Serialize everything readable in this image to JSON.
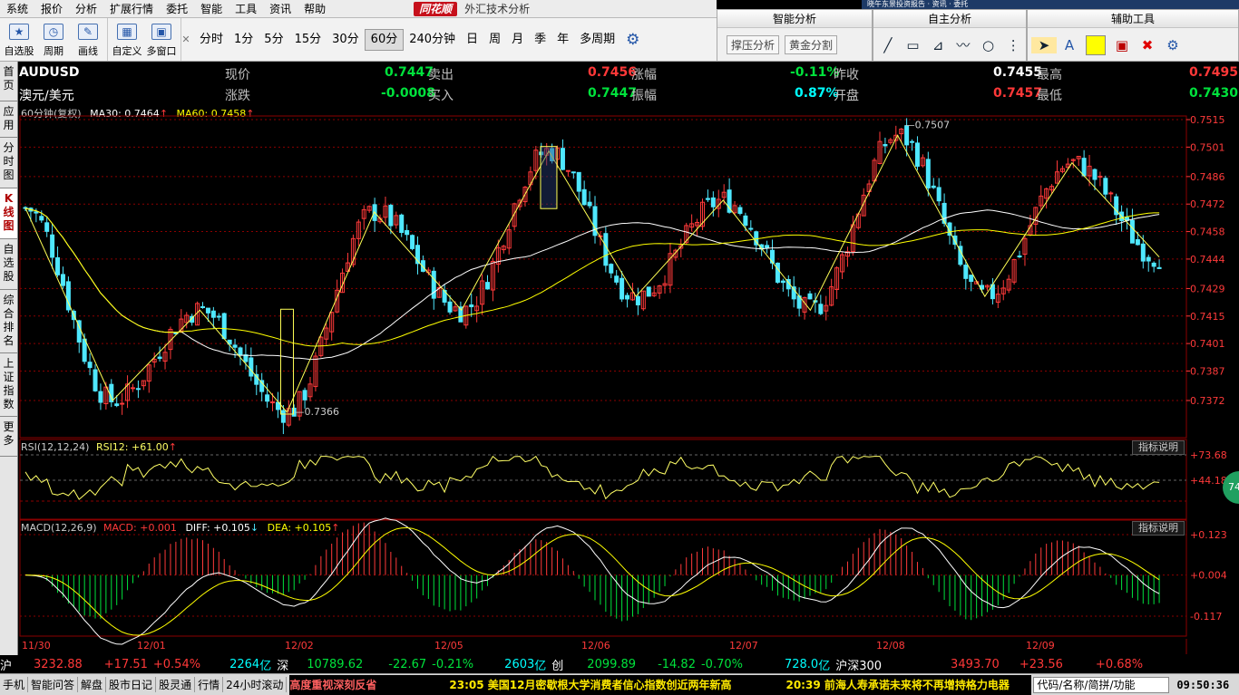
{
  "menu": {
    "items": [
      "系统",
      "报价",
      "分析",
      "扩展行情",
      "委托",
      "智能",
      "工具",
      "资讯",
      "帮助"
    ],
    "brand": "同花顺",
    "window_title": "外汇技术分析"
  },
  "toolbar": {
    "buttons": [
      {
        "label": "自选股",
        "icon": "star-icon"
      },
      {
        "label": "周期",
        "icon": "clock-icon"
      },
      {
        "label": "画线",
        "icon": "pen-icon"
      },
      {
        "label": "自定义",
        "icon": "custom-icon"
      },
      {
        "label": "多窗口",
        "icon": "window-icon"
      }
    ],
    "periods": [
      "分时",
      "1分",
      "5分",
      "15分",
      "30分",
      "60分",
      "240分钟",
      "日",
      "周",
      "月",
      "季",
      "年",
      "多周期"
    ],
    "active_period": "60分"
  },
  "panels": {
    "smart": {
      "title": "智能分析",
      "b1": "撑压分析",
      "b2": "黄金分割"
    },
    "self": {
      "title": "自主分析"
    },
    "aux": {
      "title": "辅助工具",
      "icon_a": "A"
    }
  },
  "topstrip": {
    "text": "晓午东景投资报告 · 资讯 · 委托"
  },
  "sidebar": {
    "tabs": [
      "首页",
      "应用",
      "分时图",
      "K线图",
      "自选股",
      "综合排名",
      "上证指数",
      "更多"
    ],
    "active": "K线图"
  },
  "quote": {
    "symbol": "AUDUSD",
    "name": "澳元/美元",
    "now_label": "现价",
    "now": "0.7447",
    "sell_label": "卖出",
    "sell": "0.7456",
    "rise_pct_label": "涨幅",
    "rise_pct": "-0.11%",
    "prev_close_label": "昨收",
    "prev_close": "0.7455",
    "high_label": "最高",
    "high": "0.7495",
    "change_label": "涨跌",
    "change": "-0.0008",
    "buy_label": "买入",
    "buy": "0.7447",
    "amp_label": "振幅",
    "amp": "0.87%",
    "open_label": "开盘",
    "open": "0.7457",
    "low_label": "最低",
    "low": "0.7430"
  },
  "main_chart": {
    "info": "60分钟(复权)",
    "ma30": "MA30: 0.7464",
    "ma60": "MA60: 0.7458",
    "up_arrow": "↑"
  },
  "rsi": {
    "info": "RSI(12,12,24)",
    "val": "RSI12: +61.00",
    "up_arrow": "↑",
    "explain": "指标说明",
    "circle": "74"
  },
  "macd": {
    "info": "MACD(12,26,9)",
    "macd": "MACD: +0.001",
    "diff": "DIFF: +0.105",
    "diff_arrow": "↓",
    "dea": "DEA: +0.105",
    "dea_arrow": "↑",
    "explain": "指标说明"
  },
  "colors": {
    "up": "#ff3a3a",
    "down": "#4fe8ff",
    "ma30": "#ffffff",
    "ma60": "#ffff00",
    "zigzag": "#ffff55",
    "grid": "#8b0000",
    "rsi": "#ffff66",
    "diff": "#ffffff",
    "dea": "#ffff00"
  },
  "chart_data": [
    {
      "type": "candlestick",
      "ylim": [
        0.736,
        0.7515
      ],
      "price_labels": [
        "0.7515",
        "0.7501",
        "0.7486",
        "0.7472",
        "0.7458",
        "0.7444",
        "0.7429",
        "0.7415",
        "0.7401",
        "0.7387",
        "0.7372"
      ],
      "x_labels": [
        "11/30",
        "12/01",
        "12/02",
        "12/05",
        "12/06",
        "12/07",
        "12/08",
        "12/09"
      ],
      "annotations": [
        "0.7507",
        "0.7366"
      ],
      "zigzag": [
        0.747,
        0.7372,
        0.7418,
        0.7366,
        0.7468,
        0.7418,
        0.7499,
        0.7425,
        0.7474,
        0.7418,
        0.7507,
        0.7425,
        0.7493,
        0.7445
      ]
    },
    {
      "type": "line",
      "name": "RSI",
      "ylim": [
        20,
        80
      ],
      "labels": [
        "+73.68",
        "+44.18"
      ]
    },
    {
      "type": "bar",
      "name": "MACD",
      "ylim": [
        -0.22,
        0.22
      ],
      "labels": [
        "+0.123",
        "+0.004",
        "-0.117"
      ]
    }
  ],
  "bottom": {
    "idx1": "沪",
    "v1": "3232.88",
    "c1": "+17.51",
    "p1": "+0.54%",
    "amt1": "2264",
    "u1": "亿",
    "idx2": "深",
    "v2": "10789.62",
    "c2": "-22.67",
    "p2": "-0.21%",
    "amt2": "2603",
    "u2": "亿",
    "idx3": "创",
    "v3": "2099.89",
    "c3": "-14.82",
    "p3": "-0.70%",
    "amt3": "728.0",
    "u3": "亿",
    "idx4": "沪深300",
    "v4": "3493.70",
    "c4": "+23.56",
    "p4": "+0.68%"
  },
  "status": {
    "items": [
      "手机",
      "智能问答",
      "解盘",
      "股市日记",
      "股灵通",
      "行情",
      "24小时滚动"
    ],
    "headline": "高度重视深刻反省",
    "news1": "23:05 美国12月密歇根大学消费者信心指数创近两年新高",
    "news2": "20:39 前海人寿承诺未来将不再增持格力电器",
    "code_box": "代码/名称/简拼/功能",
    "time": "09:50:36"
  }
}
